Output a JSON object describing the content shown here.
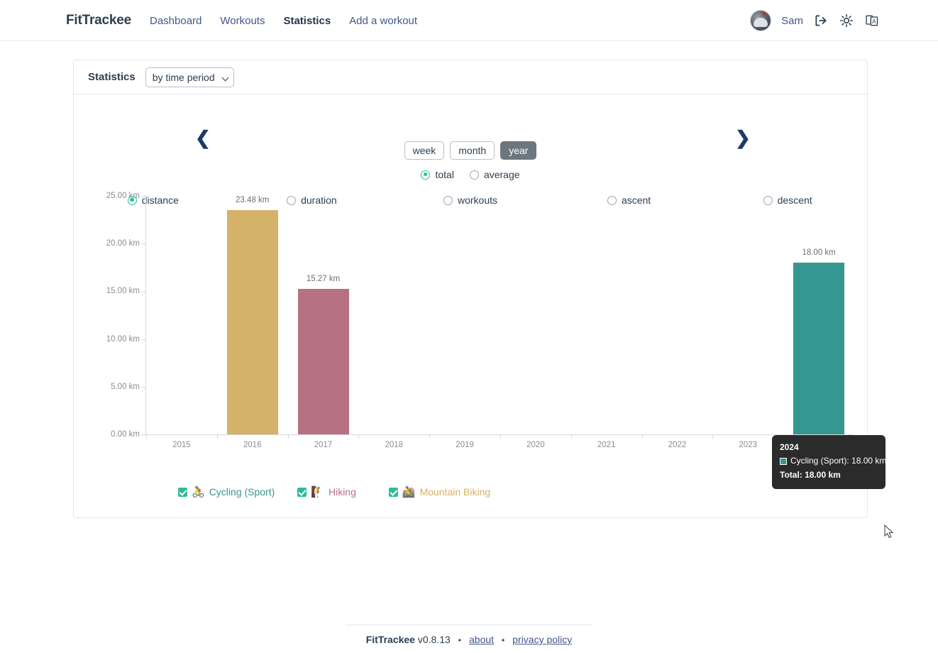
{
  "header": {
    "brand": "FitTrackee",
    "nav": [
      {
        "label": "Dashboard",
        "active": false
      },
      {
        "label": "Workouts",
        "active": false
      },
      {
        "label": "Statistics",
        "active": true
      },
      {
        "label": "Add a workout",
        "active": false
      }
    ],
    "username": "Sam",
    "icons": [
      "logout-icon",
      "theme-sun-icon",
      "language-icon"
    ]
  },
  "card": {
    "title": "Statistics",
    "select_value": "by time period",
    "select_options": [
      "by time period",
      "by sport"
    ]
  },
  "controls": {
    "prev_label": "‹",
    "next_label": "›",
    "periods": [
      {
        "label": "week",
        "active": false
      },
      {
        "label": "month",
        "active": false
      },
      {
        "label": "year",
        "active": true
      }
    ],
    "aggregation": [
      {
        "label": "total",
        "selected": true
      },
      {
        "label": "average",
        "selected": false
      }
    ],
    "metrics": [
      {
        "label": "distance",
        "selected": true
      },
      {
        "label": "duration",
        "selected": false
      },
      {
        "label": "workouts",
        "selected": false
      },
      {
        "label": "ascent",
        "selected": false
      },
      {
        "label": "descent",
        "selected": false
      }
    ]
  },
  "tooltip": {
    "title": "2024",
    "series_label": "Cycling (Sport): 18.00 km",
    "total_label": "Total: 18.00 km",
    "swatch_color": "#359792"
  },
  "legend": [
    {
      "label": "Cycling (Sport)",
      "icon": "🚴",
      "color": "#359792",
      "checked": true
    },
    {
      "label": "Hiking",
      "icon": "🧗",
      "color": "#b87180",
      "checked": true
    },
    {
      "label": "Mountain Biking",
      "icon": "🚵",
      "color": "#d4b26a",
      "checked": true
    }
  ],
  "footer": {
    "brand": "FitTrackee",
    "version": "v0.8.13",
    "sep": "•",
    "about": "about",
    "privacy": "privacy policy"
  },
  "chart_data": {
    "type": "bar",
    "title": "",
    "xlabel": "",
    "ylabel": "",
    "unit": "km",
    "ylim": [
      0,
      25
    ],
    "yticks": [
      0,
      5,
      10,
      15,
      20,
      25
    ],
    "ytick_labels": [
      "0.00 km",
      "5.00 km",
      "10.00 km",
      "15.00 km",
      "20.00 km",
      "25.00 km"
    ],
    "grid": false,
    "legend_position": "bottom-left",
    "categories": [
      "2015",
      "2016",
      "2017",
      "2018",
      "2019",
      "2020",
      "2021",
      "2022",
      "2023",
      "2024"
    ],
    "series": [
      {
        "name": "Cycling (Sport)",
        "color": "#359792",
        "values": [
          0,
          0,
          0,
          0,
          0,
          0,
          0,
          0,
          0,
          18.0
        ]
      },
      {
        "name": "Hiking",
        "color": "#b87180",
        "values": [
          0,
          0,
          15.27,
          0,
          0,
          0,
          0,
          0,
          0,
          0
        ]
      },
      {
        "name": "Mountain Biking",
        "color": "#d4b26a",
        "values": [
          0,
          23.48,
          0,
          0,
          0,
          0,
          0,
          0,
          0,
          0
        ]
      }
    ],
    "totals": [
      0,
      23.48,
      15.27,
      0,
      0,
      0,
      0,
      0,
      0,
      18.0
    ],
    "bar_labels": [
      "",
      "23.48 km",
      "15.27 km",
      "",
      "",
      "",
      "",
      "",
      "",
      "18.00 km"
    ]
  }
}
